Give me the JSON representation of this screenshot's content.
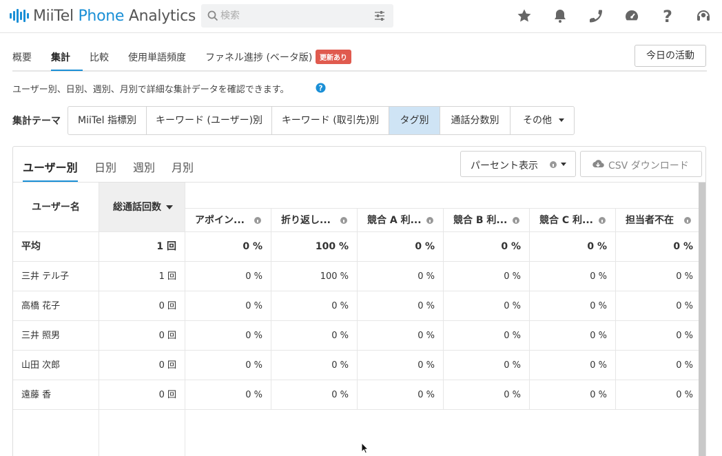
{
  "header": {
    "logo_prefix": "MiiTel",
    "logo_phone": "Phone",
    "logo_suffix": "Analytics",
    "search_placeholder": "検索",
    "icons": [
      "star-icon",
      "bell-icon",
      "phone-icon",
      "gauge-icon",
      "question-icon",
      "headset-icon"
    ]
  },
  "tabs": [
    "概要",
    "集計",
    "比較",
    "使用単語頻度",
    "ファネル進捗 (ベータ版)"
  ],
  "active_tab": "集計",
  "new_badge": "更新あり",
  "today_button": "今日の活動",
  "description": "ユーザー別、日別、週別、月別で詳細な集計データを確認できます。",
  "theme": {
    "label": "集計テーマ",
    "options": [
      "MiiTel 指標別",
      "キーワード (ユーザー)別",
      "キーワード (取引先)別",
      "タグ別",
      "通話分数別",
      "その他"
    ],
    "selected": "タグ別"
  },
  "subtabs": [
    "ユーザー別",
    "日別",
    "週別",
    "月別"
  ],
  "active_subtab": "ユーザー別",
  "percent_button": "パーセント表示",
  "csv_button": "CSV ダウンロード",
  "table": {
    "user_header": "ユーザー名",
    "total_header": "総通話回数",
    "columns": [
      "アポイン...",
      "折り返し...",
      "競合 A 利...",
      "競合 B 利...",
      "競合 C 利...",
      "担当者不在"
    ],
    "average": {
      "name": "平均",
      "total": "1 回",
      "values": [
        "0 %",
        "100 %",
        "0 %",
        "0 %",
        "0 %",
        "0 %"
      ]
    },
    "rows": [
      {
        "name": "三井 テル子",
        "total": "1 回",
        "values": [
          "0 %",
          "100 %",
          "0 %",
          "0 %",
          "0 %",
          "0 %"
        ]
      },
      {
        "name": "高橋 花子",
        "total": "0 回",
        "values": [
          "0 %",
          "0 %",
          "0 %",
          "0 %",
          "0 %",
          "0 %"
        ]
      },
      {
        "name": "三井 照男",
        "total": "0 回",
        "values": [
          "0 %",
          "0 %",
          "0 %",
          "0 %",
          "0 %",
          "0 %"
        ]
      },
      {
        "name": "山田 次郎",
        "total": "0 回",
        "values": [
          "0 %",
          "0 %",
          "0 %",
          "0 %",
          "0 %",
          "0 %"
        ]
      },
      {
        "name": "遠藤 香",
        "total": "0 回",
        "values": [
          "0 %",
          "0 %",
          "0 %",
          "0 %",
          "0 %",
          "0 %"
        ]
      }
    ]
  },
  "colors": {
    "accent": "#1a8fd6",
    "selected_bg": "#cfe4f5",
    "badge": "#e05a4e"
  }
}
